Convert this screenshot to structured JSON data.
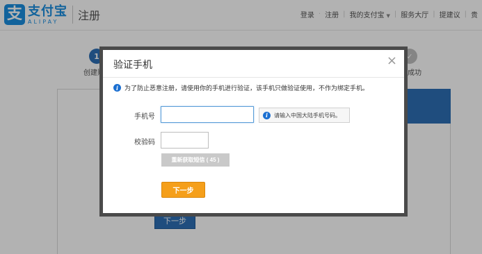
{
  "header": {
    "logo_cn": "支付宝",
    "logo_en": "ALIPAY",
    "logo_glyph": "支",
    "page_title": "注册",
    "nav": [
      {
        "label": "登录"
      },
      {
        "label": "·"
      },
      {
        "label": "注册"
      },
      {
        "label": "|"
      },
      {
        "label": "我的支付宝"
      },
      {
        "label": "|"
      },
      {
        "label": "服务大厅"
      },
      {
        "label": "|"
      },
      {
        "label": "提建议"
      },
      {
        "label": "|"
      },
      {
        "label": "贵"
      }
    ]
  },
  "steps": [
    {
      "number": "1",
      "label": "创建账",
      "state": "active"
    },
    {
      "number": "",
      "label": "",
      "state": "gray"
    },
    {
      "number": "",
      "label": "",
      "state": "gray"
    },
    {
      "number": "",
      "label": "成功",
      "state": "gray"
    }
  ],
  "background_page": {
    "next_label": "下一步"
  },
  "modal": {
    "title": "验证手机",
    "close": "×",
    "notice": "为了防止恶意注册，请使用你的手机进行验证，该手机只做验证使用，不作为绑定手机。",
    "phone_label": "手机号",
    "phone_value": "",
    "phone_tip": "请输入中国大陆手机号码。",
    "code_label": "校验码",
    "code_value": "",
    "resend_label": "重新获取短信 ( 45 )",
    "next_label": "下一步"
  },
  "colors": {
    "brand_blue": "#1b8fe0",
    "step_blue": "#2d6fb5",
    "next_orange": "#f59f1a",
    "disabled_gray": "#c9c9c9"
  }
}
